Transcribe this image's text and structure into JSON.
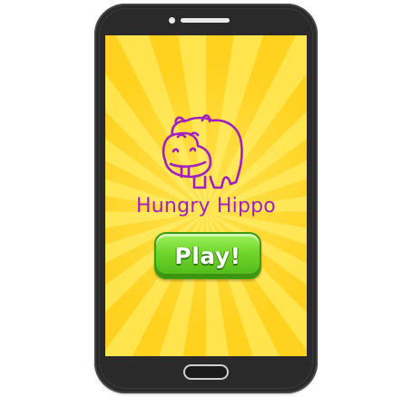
{
  "app": {
    "title": "Hungry Hippo",
    "logo_icon": "hippo-icon"
  },
  "actions": {
    "play_label": "Play!"
  },
  "colors": {
    "background": "#ffd21f",
    "title": "#a21fc0",
    "play_button": "#6fd42a",
    "phone_body": "#2a2a2a"
  }
}
